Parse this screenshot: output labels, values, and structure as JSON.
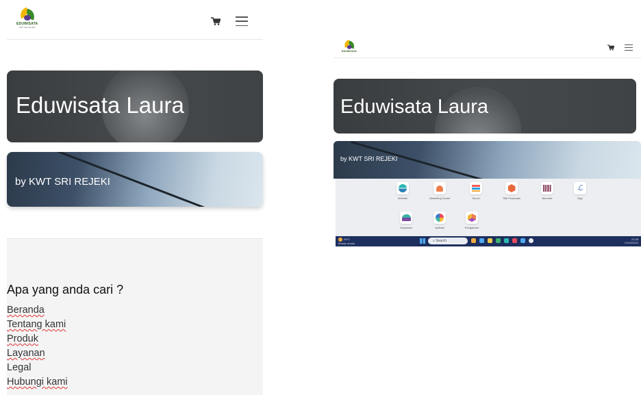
{
  "brand": {
    "logo_text": "EDUWISATA",
    "logo_sub": "KWT SRI REJEKI"
  },
  "hero": {
    "title": "Eduwisata Laura"
  },
  "subtitle": {
    "text": "by KWT SRI REJEKI"
  },
  "menu": {
    "heading": "Apa yang anda cari ?",
    "items": [
      "Beranda",
      "Tentang kami",
      "Produk",
      "Layanan",
      "Legal",
      "Hubungi kami"
    ]
  },
  "launcher": {
    "apps": [
      {
        "label": "Website",
        "icon": "website-icon"
      },
      {
        "label": "Marketing Sosial",
        "icon": "heart-icon"
      },
      {
        "label": "Survei",
        "icon": "survey-icon"
      },
      {
        "label": "Titik Penjualan",
        "icon": "pos-icon"
      },
      {
        "label": "Barcode",
        "icon": "barcode-icon"
      },
      {
        "label": "Sign",
        "icon": "sign-icon"
      },
      {
        "label": "Karyawan",
        "icon": "employees-icon"
      },
      {
        "label": "Aplikasi",
        "icon": "apps-icon"
      },
      {
        "label": "Pengaturan",
        "icon": "settings-icon"
      }
    ]
  },
  "taskbar": {
    "weather_temp": "28°C",
    "weather_desc": "Mostly cloudy",
    "search_placeholder": "Search",
    "clock_time": "23.38",
    "clock_date": "21/03/2024"
  },
  "colors": {
    "hero_bg": "#404446",
    "taskbar_bg": "#1d2f5e",
    "menu_bg": "#f4f4f4"
  }
}
